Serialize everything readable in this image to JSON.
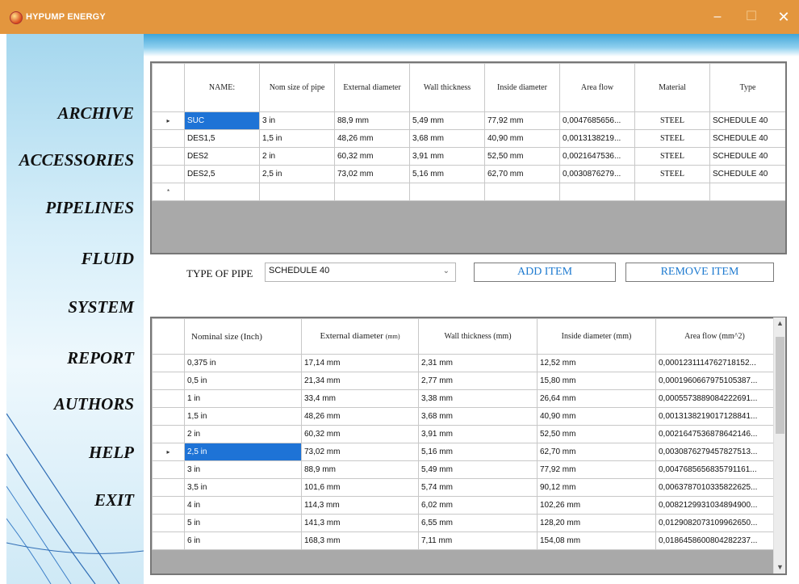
{
  "window": {
    "title": "HYPUMP ENERGY",
    "minimize": "‒",
    "maximize": "☐",
    "close": "✕"
  },
  "sidebar": {
    "items": [
      {
        "label": "ARCHIVE"
      },
      {
        "label": "ACCESSORIES"
      },
      {
        "label": "PIPELINES"
      },
      {
        "label": "FLUID"
      },
      {
        "label": "SYSTEM"
      },
      {
        "label": "REPORT"
      },
      {
        "label": "AUTHORS"
      },
      {
        "label": "HELP"
      },
      {
        "label": "EXIT"
      }
    ]
  },
  "pipes_table": {
    "columns": [
      "NAME:",
      "Nom size of pipe",
      "External diameter",
      "Wall thickness",
      "Inside diameter",
      "Area flow",
      "Material",
      "Type"
    ],
    "current_row_marker": "▸",
    "new_row_marker": "*",
    "rows": [
      [
        "SUC",
        "3 in",
        "88,9 mm",
        "5,49 mm",
        "77,92 mm",
        "0,0047685656...",
        "STEEL",
        "SCHEDULE 40"
      ],
      [
        "DES1,5",
        "1,5 in",
        "48,26 mm",
        "3,68 mm",
        "40,90 mm",
        "0,0013138219...",
        "STEEL",
        "SCHEDULE 40"
      ],
      [
        "DES2",
        "2 in",
        "60,32 mm",
        "3,91 mm",
        "52,50 mm",
        "0,0021647536...",
        "STEEL",
        "SCHEDULE 40"
      ],
      [
        "DES2,5",
        "2,5 in",
        "73,02 mm",
        "5,16 mm",
        "62,70 mm",
        "0,0030876279...",
        "STEEL",
        "SCHEDULE 40"
      ]
    ]
  },
  "controls": {
    "type_label": "TYPE OF PIPE",
    "type_value": "SCHEDULE 40",
    "add_button": "ADD ITEM",
    "remove_button": "REMOVE ITEM"
  },
  "sizes_table": {
    "columns": [
      "Nominal size (Inch)",
      "External diameter",
      "Wall thickness (mm)",
      "Inside diameter (mm)",
      "Area flow (mm^2)"
    ],
    "ext_unit": "(mm)",
    "current_row_marker": "▸",
    "rows": [
      [
        "0,375 in",
        "17,14 mm",
        "2,31 mm",
        "12,52 mm",
        "0,0001231114762718152..."
      ],
      [
        "0,5 in",
        "21,34 mm",
        "2,77 mm",
        "15,80 mm",
        "0,0001960667975105387..."
      ],
      [
        "1 in",
        "33,4 mm",
        "3,38 mm",
        "26,64 mm",
        "0,0005573889084222691..."
      ],
      [
        "1,5 in",
        "48,26 mm",
        "3,68 mm",
        "40,90 mm",
        "0,0013138219017128841..."
      ],
      [
        "2 in",
        "60,32 mm",
        "3,91 mm",
        "52,50 mm",
        "0,0021647536878642146..."
      ],
      [
        "2,5 in",
        "73,02 mm",
        "5,16 mm",
        "62,70 mm",
        "0,0030876279457827513..."
      ],
      [
        "3 in",
        "88,9 mm",
        "5,49 mm",
        "77,92 mm",
        "0,0047685656835791161..."
      ],
      [
        "3,5 in",
        "101,6 mm",
        "5,74 mm",
        "90,12 mm",
        "0,0063787010335822625..."
      ],
      [
        "4 in",
        "114,3 mm",
        "6,02 mm",
        "102,26 mm",
        "0,0082129931034894900..."
      ],
      [
        "5 in",
        "141,3 mm",
        "6,55 mm",
        "128,20 mm",
        "0,0129082073109962650..."
      ],
      [
        "6 in",
        "168,3 mm",
        "7,11 mm",
        "154,08 mm",
        "0,0186458600804282237..."
      ]
    ]
  },
  "colors": {
    "titlebar": "#e3963e",
    "selection": "#1e73d6",
    "button_text": "#1f7bd0"
  }
}
